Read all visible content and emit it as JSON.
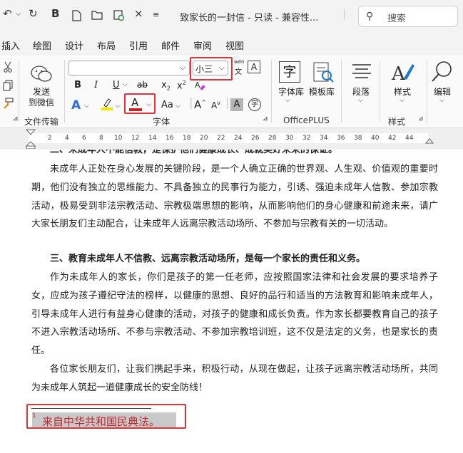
{
  "titlebar": {
    "title": "致家长的一封信 - 只读 - 兼容性...",
    "search_placeholder": "搜索",
    "undo_glyph": "↶",
    "redo_glyph": "↻",
    "bold_glyph": "B",
    "close_glyph": "×",
    "separator": "|"
  },
  "menu": [
    "插入",
    "绘图",
    "设计",
    "布局",
    "引用",
    "邮件",
    "审阅",
    "视图"
  ],
  "ribbon": {
    "send_label_1": "发送",
    "send_label_2": "到微信",
    "group_file_transfer": "文件传输",
    "font_size_value": "小三",
    "group_font": "字体",
    "font_lib": "字体库",
    "template_lib": "模板库",
    "group_officeplus": "OfficePLUS",
    "paragraph": "段落",
    "styles": "样式",
    "group_styles": "样式",
    "editing": "编辑",
    "wen_label": "wén",
    "wen_char": "文",
    "char_zi": "字",
    "bold": "B",
    "italic": "I",
    "underline": "U",
    "strike": "ab",
    "subscript": "x",
    "superscript": "x",
    "clear_format": "A",
    "text_effect": "A",
    "font_color": "A",
    "case_btn": "Aa",
    "grow_font": "A",
    "shrink_font": "A",
    "char_shading": "A",
    "enclose_char": "字",
    "border_char": "A"
  },
  "ruler": {
    "ticks": [
      "2",
      "4",
      "6",
      "8",
      "10",
      "12",
      "14",
      "16",
      "18",
      "20",
      "22",
      "24",
      "26",
      "28",
      "30",
      "32",
      "34",
      "36",
      "38",
      "40",
      "42",
      "44"
    ]
  },
  "doc": {
    "partial_heading": "二、未成年人不能信教，是保护他们健康成长、成就美好未来的保证。",
    "para1": "未成年人正处在身心发展的关键阶段，是一个人确立正确的世界观、人生观、价值观的重要时期，他们没有独立的思维能力、不具备独立的民事行为能力，引诱、强迫未成年人信教、参加宗教活动，极易受到非法宗教活动、宗教极端思想的影响，从而影响他们的身心健康和前途未来，请广大家长朋友们主动配合，让未成年人远离宗教活动场所、不参加与宗教有关的一切活动。",
    "heading3": "三、教育未成年人不信教、远离宗教活动场所，是每一个家长的责任和义务。",
    "para2": "作为未成年人的家长，你们是孩子的第一任老师，应按照国家法律和社会发展的要求培养子女，应成为孩子遵纪守法的榜样，以健康的思想、良好的品行和适当的方法教育和影响未成年人，引导未成年人进行有益身心健康的活动，对孩子的健康和成长负责。作为家长都要教育自己的孩子不进入宗教活动场所、不参与宗教活动、不参加宗教培训班，这不仅是法定的义务，也是家长的责任。",
    "para3": "各位家长朋友们，让我们携起手来，积极行动，从现在做起，让孩子远离宗教活动场所，共同为未成年人筑起一道健康成长的安全防线！",
    "footnote_mark": "1",
    "footnote_text": "来自中华共和国民典法。"
  },
  "colors": {
    "highlight_red": "#e0343c",
    "font_color_bar": "#d01f1f",
    "highlight_bar": "#f5e600",
    "footnote_text": "#c0282d",
    "text_effect_blue": "#2f6fd6"
  }
}
